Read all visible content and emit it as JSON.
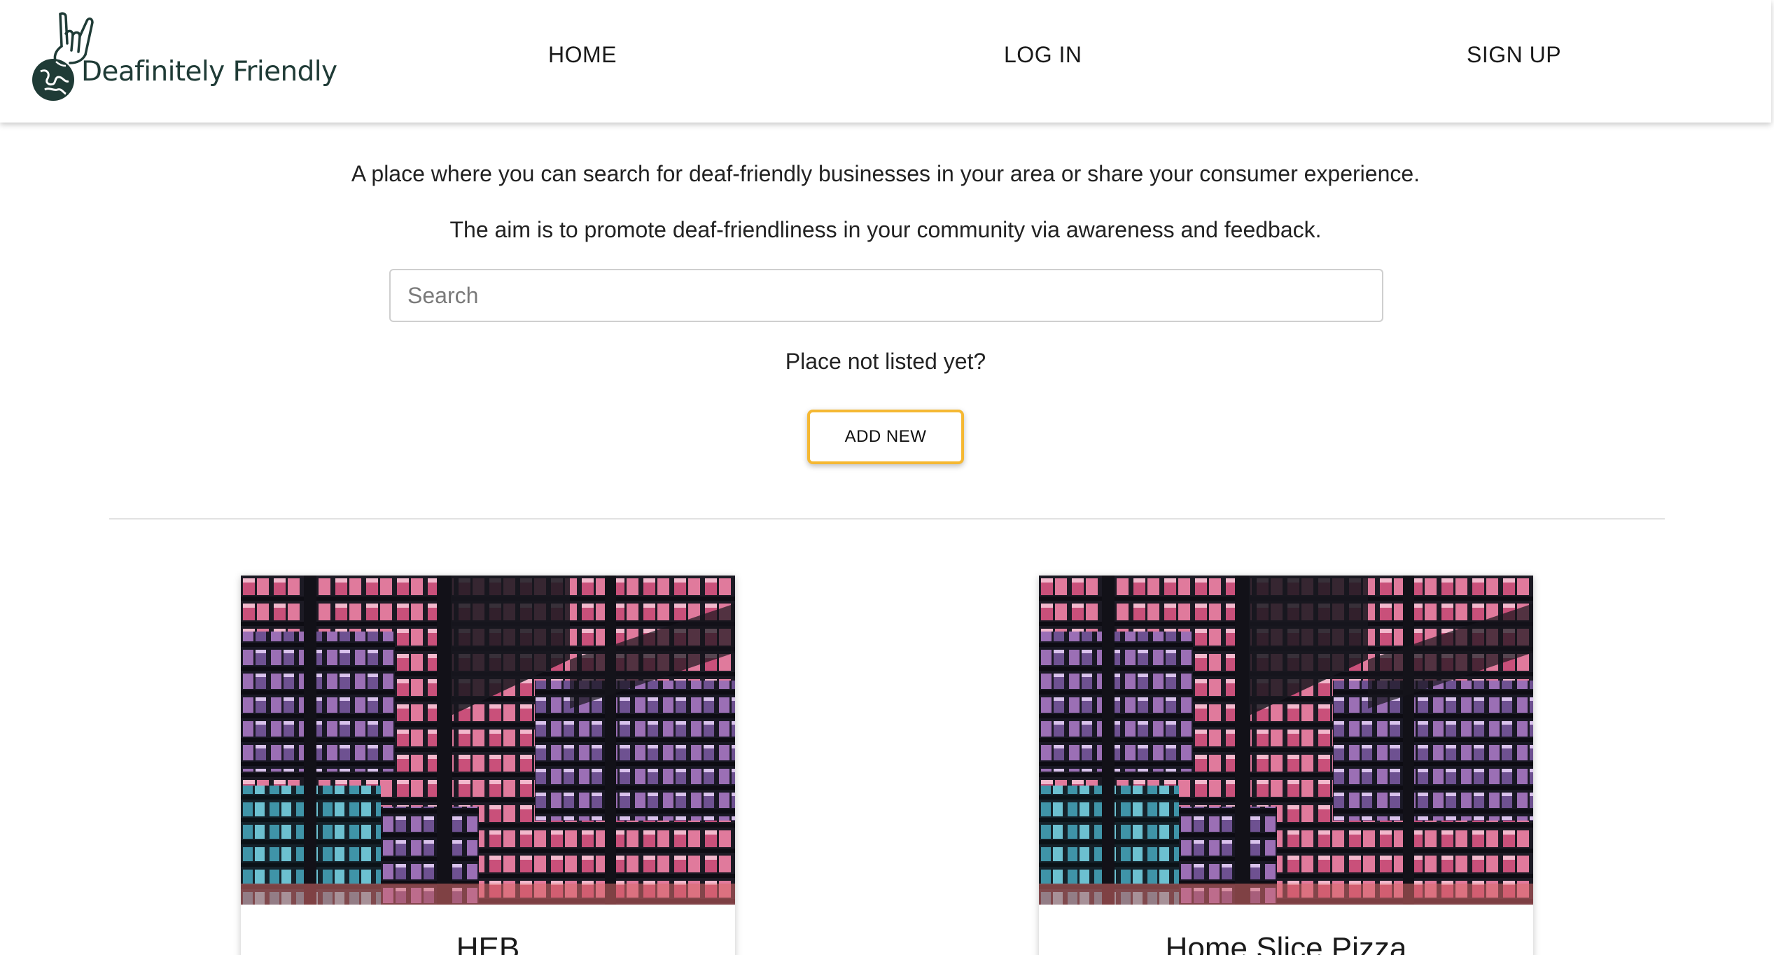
{
  "brand": {
    "name": "Deafinitely Friendly",
    "logo_icon": "hand-globe-icon",
    "color": "#1f3b36"
  },
  "nav": {
    "home": "HOME",
    "login": "LOG IN",
    "signup": "SIGN UP"
  },
  "hero": {
    "line1": "A place where you can search for deaf-friendly businesses in your area or share your consumer experience.",
    "line2": "The aim is to promote deaf-friendliness in your community via awareness and feedback."
  },
  "search": {
    "placeholder": "Search",
    "value": ""
  },
  "add": {
    "prompt": "Place not listed yet?",
    "button": "ADD NEW",
    "accent": "#f5b833"
  },
  "cards": [
    {
      "title": "HEB",
      "image": "office-building-night-photo"
    },
    {
      "title": "Home Slice Pizza",
      "image": "office-building-night-photo"
    }
  ]
}
